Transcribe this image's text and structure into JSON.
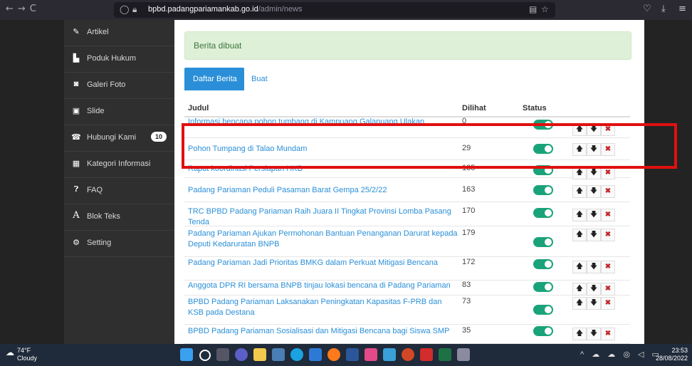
{
  "browser": {
    "url_domain": "bpbd.padangpariamankab.go.id",
    "url_path": "/admin/news"
  },
  "sidebar": {
    "items": [
      {
        "label": "Artikel",
        "icon": "pencil-icon"
      },
      {
        "label": "Poduk Hukum",
        "icon": "gavel-icon"
      },
      {
        "label": "Galeri Foto",
        "icon": "camera-icon"
      },
      {
        "label": "Slide",
        "icon": "image-icon"
      },
      {
        "label": "Hubungi Kami",
        "icon": "phone-icon",
        "badge": "10"
      },
      {
        "label": "Kategori Informasi",
        "icon": "list-icon"
      },
      {
        "label": "FAQ",
        "icon": "question-icon"
      },
      {
        "label": "Blok Teks",
        "icon": "text-icon"
      },
      {
        "label": "Setting",
        "icon": "gear-icon"
      }
    ]
  },
  "alert": {
    "text": "Berita dibuat"
  },
  "tabs": {
    "active": "Daftar Berita",
    "other": "Buat"
  },
  "table": {
    "headers": {
      "title": "Judul",
      "views": "Dilihat",
      "status": "Status"
    },
    "rows": [
      {
        "title": "Informasi bencana pohon tumbang di Kampuang Galapuang Ulakan",
        "views": "0"
      },
      {
        "title": "Pohon Tumpang di Talao Mundam",
        "views": "29"
      },
      {
        "title": "Rapat koordinasi Persiapan HKB",
        "views": "135"
      },
      {
        "title": "Padang Pariaman Peduli Pasaman Barat Gempa 25/2/22",
        "views": "163"
      },
      {
        "title": "TRC BPBD Padang Pariaman Raih Juara II Tingkat Provinsi Lomba Pasang Tenda",
        "views": "170"
      },
      {
        "title": "Padang Pariaman Ajukan Permohonan Bantuan Penanganan Darurat kepada Deputi Kedaruratan BNPB",
        "views": "179"
      },
      {
        "title": "Padang Pariaman Jadi Prioritas BMKG dalam Perkuat Mitigasi Bencana",
        "views": "172"
      },
      {
        "title": "Anggota DPR RI bersama BNPB tinjau lokasi bencana di Padang Pariaman",
        "views": "83"
      },
      {
        "title": "BPBD Padang Pariaman Laksanakan Peningkatan Kapasitas F-PRB dan KSB pada Destana",
        "views": "73"
      },
      {
        "title": "BPBD Padang Pariaman Sosialisasi dan Mitigasi Bencana bagi Siswa SMP",
        "views": "35"
      }
    ],
    "btn_up": "🡅",
    "btn_down": "🡇",
    "btn_delete": "✖"
  },
  "taskbar": {
    "temp": "74°F",
    "weather": "Cloudy",
    "time": "23:53",
    "date": "28/08/2022"
  },
  "colors": {
    "accent": "#2a8fd8",
    "toggle_on": "#1aa37a",
    "highlight": "#e01010"
  }
}
